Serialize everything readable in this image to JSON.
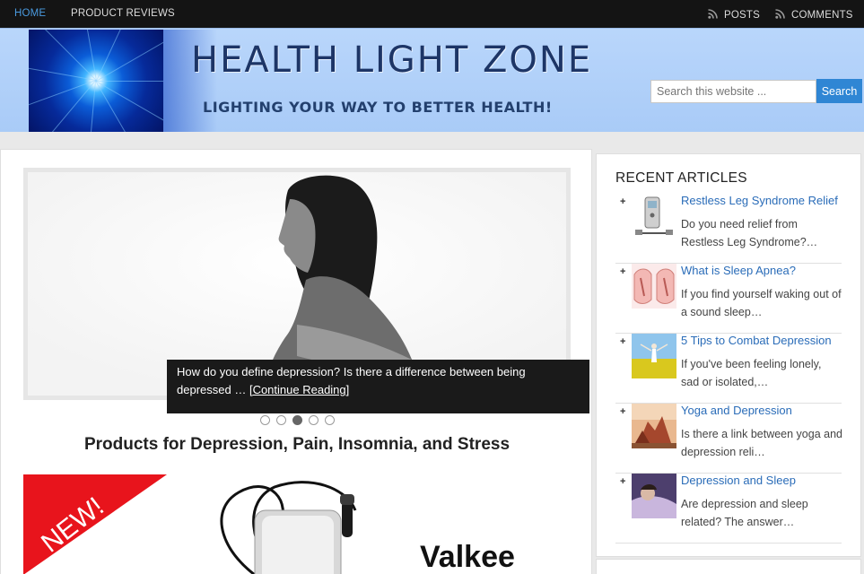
{
  "nav": {
    "left": [
      "HOME",
      "PRODUCT REVIEWS"
    ],
    "posts_label": "POSTS",
    "comments_label": "COMMENTS"
  },
  "header": {
    "title": "HEALTH LIGHT ZONE",
    "tagline": "LIGHTING YOUR WAY TO BETTER HEALTH!",
    "search_placeholder": "Search this website ...",
    "search_button": "Search"
  },
  "slider": {
    "caption_text": "How do you define depression? Is there a difference between being depressed …",
    "caption_link": "[Continue Reading]",
    "active_dot": 3,
    "dot_count": 5
  },
  "main": {
    "products_heading": "Products for Depression, Pain, Insomnia, and Stress",
    "promo_badge": "NEW!",
    "promo_brand": "Valkee"
  },
  "sidebar": {
    "heading": "RECENT ARTICLES",
    "articles": [
      {
        "title": "Restless Leg Syndrome Relief",
        "excerpt": "Do you need relief from Restless Leg Syndrome?…",
        "thumb": "tens-device-thumbnail"
      },
      {
        "title": "What is Sleep Apnea?",
        "excerpt": "If you find yourself waking out of a sound sleep…",
        "thumb": "airway-diagram-thumbnail"
      },
      {
        "title": "5 Tips to Combat Depression",
        "excerpt": "If you've been feeling lonely, sad or isolated,…",
        "thumb": "woman-in-field-thumbnail"
      },
      {
        "title": "Yoga and Depression",
        "excerpt": "Is there a link between yoga and depression reli…",
        "thumb": "yoga-class-thumbnail"
      },
      {
        "title": "Depression and Sleep",
        "excerpt": "Are depression and sleep related? The answer…",
        "thumb": "sleeping-person-thumbnail"
      }
    ]
  },
  "colors": {
    "nav_bg": "#141414",
    "nav_active": "#4a9be0",
    "header_bg": "#a9cbf7",
    "title_color": "#1d3566",
    "link_color": "#2a6cb8",
    "search_button": "#2f86d4"
  }
}
